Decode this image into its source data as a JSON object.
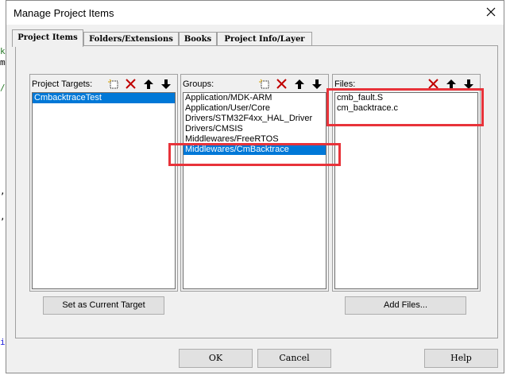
{
  "dialog": {
    "title": "Manage Project Items"
  },
  "tabs": [
    {
      "label": "Project Items"
    },
    {
      "label": "Folders/Extensions"
    },
    {
      "label": "Books"
    },
    {
      "label": "Project Info/Layer"
    }
  ],
  "project_targets": {
    "label": "Project Targets:",
    "items": [
      "CmbacktraceTest"
    ],
    "selected": "CmbacktraceTest",
    "button": "Set as Current Target"
  },
  "groups": {
    "label": "Groups:",
    "items": [
      "Application/MDK-ARM",
      "Application/User/Core",
      "Drivers/STM32F4xx_HAL_Driver",
      "Drivers/CMSIS",
      "Middlewares/FreeRTOS",
      "Middlewares/CmBacktrace"
    ],
    "selected": "Middlewares/CmBacktrace"
  },
  "files": {
    "label": "Files:",
    "items": [
      "cmb_fault.S",
      "cm_backtrace.c"
    ],
    "button": "Add Files..."
  },
  "footer": {
    "ok": "OK",
    "cancel": "Cancel",
    "help": "Help"
  },
  "icons": {
    "close": "close-icon",
    "new": "new-item-icon",
    "delete": "delete-icon",
    "up": "move-up-icon",
    "down": "move-down-icon"
  },
  "colors": {
    "selection": "#0078d7",
    "highlight": "#e8333a",
    "delete_icon": "#c00000"
  }
}
